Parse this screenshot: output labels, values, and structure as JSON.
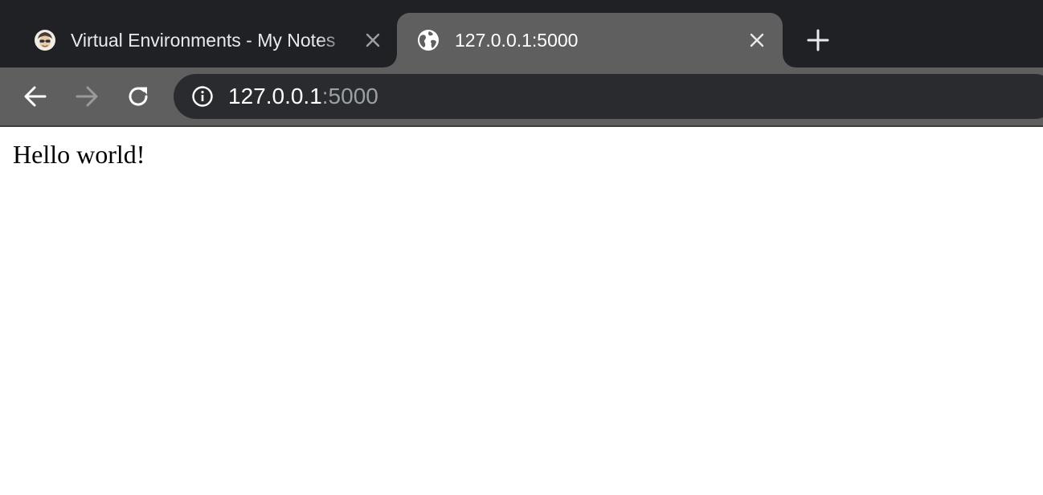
{
  "tabs": [
    {
      "title": "Virtual Environments - My Notes",
      "favicon": "avatar-icon",
      "active": false
    },
    {
      "title": "127.0.0.1:5000",
      "favicon": "globe-icon",
      "active": true
    }
  ],
  "toolbar": {
    "back_icon": "back-arrow-icon",
    "forward_icon": "forward-arrow-icon",
    "forward_enabled": false,
    "reload_icon": "reload-icon"
  },
  "omnibox": {
    "security_icon": "info-icon",
    "url_host": "127.0.0.1",
    "url_port": ":5000"
  },
  "page": {
    "text": "Hello world!"
  },
  "colors": {
    "tabstrip_bg": "#202124",
    "active_tab_bg": "#5f5f5f",
    "omnibox_bg": "#292b2f",
    "url_port_color": "#9aa0a6",
    "page_bg": "#ffffff"
  }
}
